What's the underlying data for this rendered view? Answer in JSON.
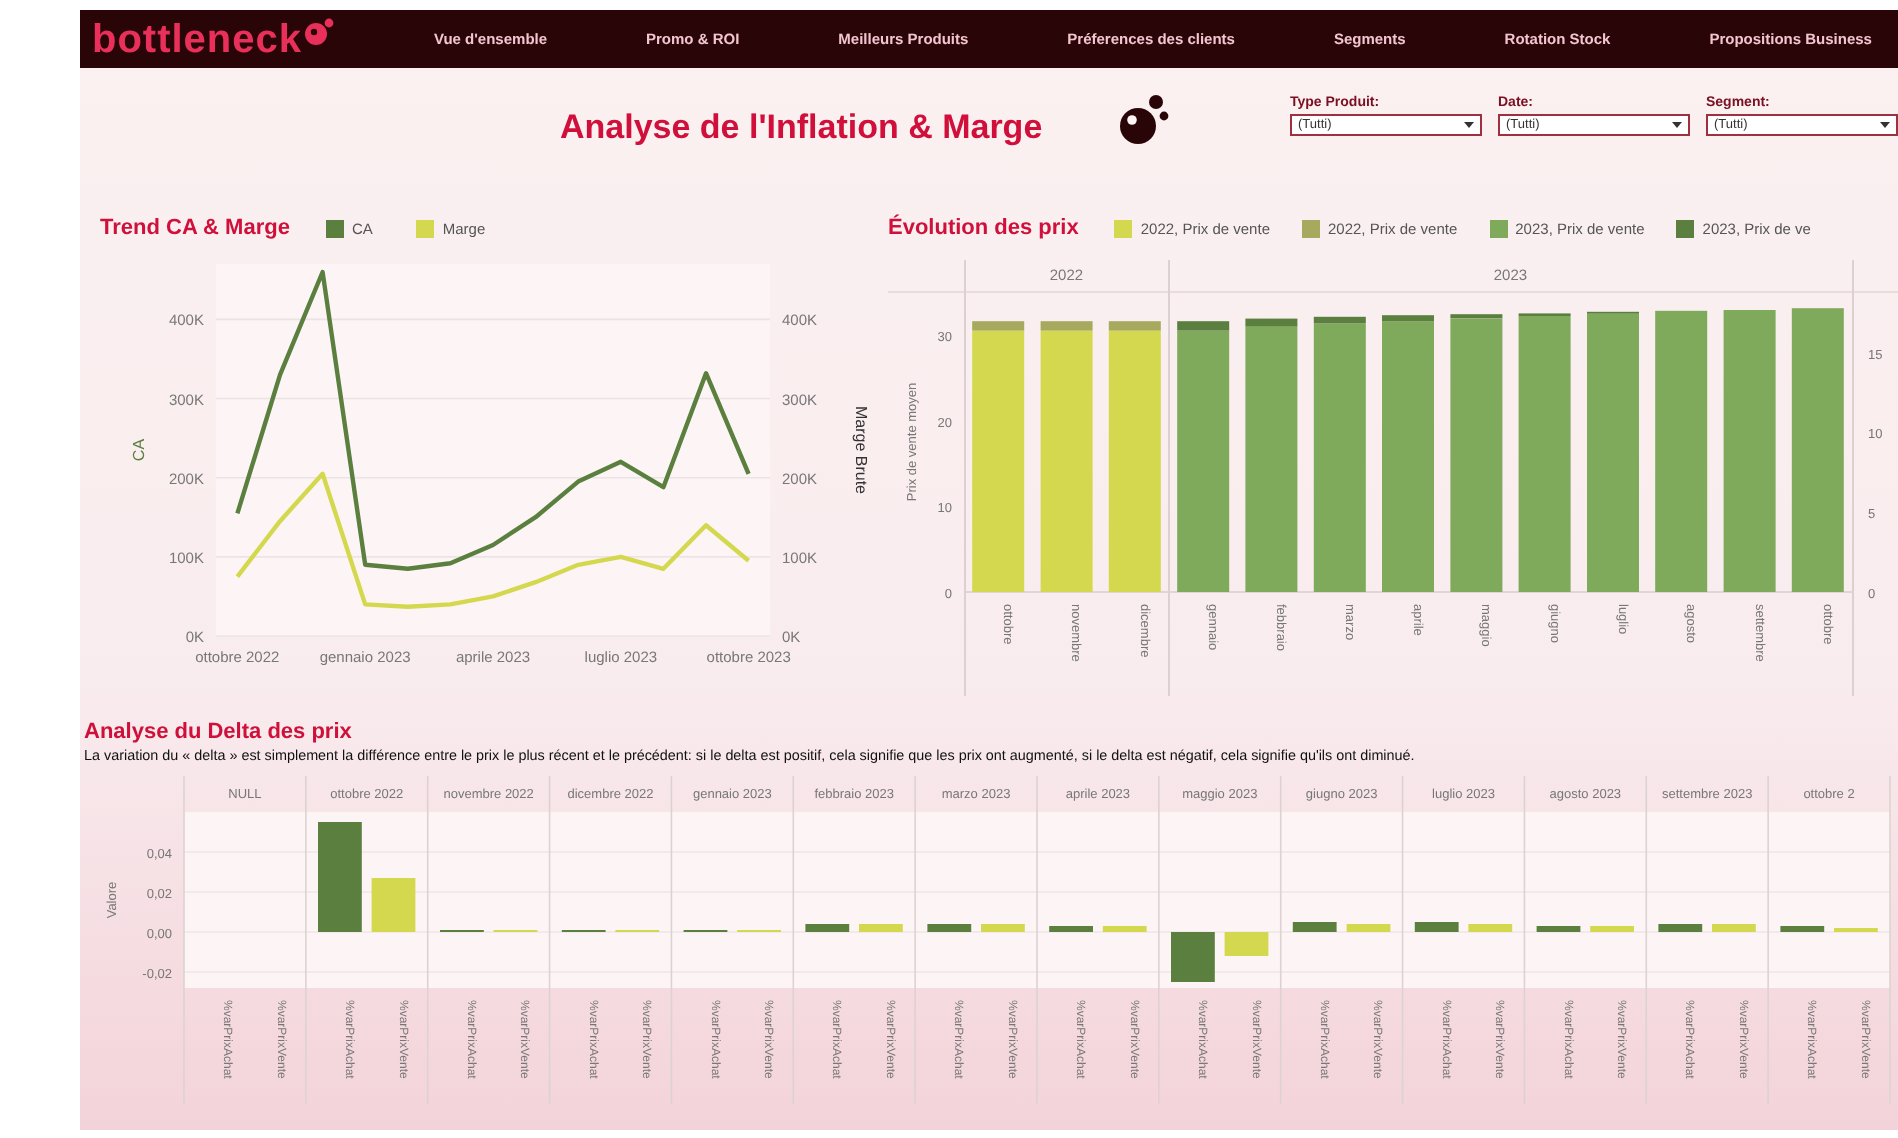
{
  "header": {
    "logo": "bottleneck",
    "nav": [
      {
        "label": "Vue d'ensemble",
        "selected": false
      },
      {
        "label": "Promo & ROI",
        "selected": false
      },
      {
        "label": "Meilleurs Produits",
        "selected": false
      },
      {
        "label": "Préferences des clients",
        "selected": false
      },
      {
        "label": "Segments",
        "selected": false
      },
      {
        "label": "Rotation Stock",
        "selected": false
      },
      {
        "label": "Propositions Business",
        "selected": false
      }
    ]
  },
  "title": "Analyse de l'Inflation & Marge",
  "filters": [
    {
      "label": "Type Produit:",
      "value": "(Tutti)"
    },
    {
      "label": "Date:",
      "value": "(Tutti)"
    },
    {
      "label": "Segment:",
      "value": "(Tutti)"
    }
  ],
  "trend": {
    "title": "Trend CA & Marge",
    "chart_data": {
      "type": "line",
      "ylabel": "CA",
      "y2label": "Marge Brute",
      "grid": true,
      "categories": [
        "ottobre 2022",
        null,
        null,
        "gennaio 2023",
        null,
        null,
        "aprile 2023",
        null,
        null,
        "luglio 2023",
        null,
        null,
        "ottobre 2023"
      ],
      "y2lim": [
        0,
        470000
      ],
      "series": [
        {
          "name": "CA",
          "color": "#5b7f3f",
          "values": [
            155000,
            330000,
            460000,
            90000,
            85000,
            92000,
            115000,
            150000,
            195000,
            220000,
            188000,
            332000,
            205000
          ]
        },
        {
          "name": "Marge",
          "color": "#d4d84f",
          "values": [
            75000,
            145000,
            205000,
            40000,
            37000,
            40000,
            50000,
            68000,
            90000,
            100000,
            85000,
            140000,
            95000
          ]
        }
      ],
      "ylim": [
        0,
        470000
      ],
      "yticks": [
        {
          "value": 0,
          "label": "0K"
        },
        {
          "value": 100000,
          "label": "100K"
        },
        {
          "value": 200000,
          "label": "200K"
        },
        {
          "value": 300000,
          "label": "300K"
        },
        {
          "value": 400000,
          "label": "400K"
        }
      ],
      "y2ticks": [
        {
          "value": 0,
          "label": "0K"
        },
        {
          "value": 100000,
          "label": "100K"
        },
        {
          "value": 200000,
          "label": "200K"
        },
        {
          "value": 300000,
          "label": "300K"
        },
        {
          "value": 400000,
          "label": "400K"
        }
      ]
    }
  },
  "prices": {
    "title": "Évolution des prix",
    "year_headers": [
      "2022",
      "2023"
    ],
    "chart_data": {
      "type": "bar",
      "stacked": true,
      "ylabel": "Prix de vente moyen",
      "categories": [
        "ottobre",
        "novembre",
        "dicembre",
        "gennaio",
        "febbraio",
        "marzo",
        "aprile",
        "maggio",
        "giugno",
        "luglio",
        "agosto",
        "settembre",
        "ottobre"
      ],
      "series": [
        {
          "name": "2022, Prix de vente",
          "color": "#d4d84f",
          "values": [
            30.5,
            30.5,
            30.5,
            null,
            null,
            null,
            null,
            null,
            null,
            null,
            null,
            null,
            null
          ]
        },
        {
          "name": "2022, Prix de vente",
          "color": "#a7a95f",
          "values": [
            1.1,
            1.1,
            1.1,
            null,
            null,
            null,
            null,
            null,
            null,
            null,
            null,
            null,
            null
          ]
        },
        {
          "name": "2023, Prix de vente",
          "color": "#7fa95b",
          "values": [
            null,
            null,
            null,
            30.5,
            31,
            31.3,
            31.6,
            31.9,
            32.2,
            32.5,
            32.8,
            32.9,
            33.1
          ]
        },
        {
          "name": "2023, Prix de ve",
          "color": "#5b7f3f",
          "values": [
            null,
            null,
            null,
            1.1,
            0.9,
            0.8,
            0.7,
            0.5,
            0.3,
            0.2,
            0,
            0,
            0
          ]
        }
      ],
      "ylim": [
        0,
        35
      ],
      "yticks": [
        0,
        10,
        20,
        30
      ],
      "y2lim": [
        0,
        18.8
      ],
      "y2ticks": [
        0,
        5,
        10,
        15
      ]
    }
  },
  "delta": {
    "title": "Analyse du Delta des prix",
    "description": "La variation du « delta » est simplement la différence entre le prix le plus récent et le précédent: si le delta est positif, cela signifie que les prix ont augmenté, si le delta est négatif, cela signifie qu'ils ont diminué.",
    "chart_data": {
      "type": "bar",
      "ylabel": "Valore",
      "grid": true,
      "categories": [
        "NULL",
        "ottobre 2022",
        "novembre 2022",
        "dicembre 2022",
        "gennaio 2023",
        "febbraio 2023",
        "marzo 2023",
        "aprile 2023",
        "maggio 2023",
        "giugno 2023",
        "luglio 2023",
        "agosto 2023",
        "settembre 2023",
        "ottobre 2"
      ],
      "series": [
        {
          "name": "%varPrixAchat",
          "color": "#5b7f3f",
          "values": [
            null,
            0.055,
            0.001,
            0.001,
            0.001,
            0.004,
            0.004,
            0.003,
            -0.025,
            0.005,
            0.005,
            0.003,
            0.004,
            0.003
          ]
        },
        {
          "name": "%varPrixVente",
          "color": "#d4d84f",
          "values": [
            null,
            0.027,
            0.001,
            0.001,
            0.001,
            0.004,
            0.004,
            0.003,
            -0.012,
            0.004,
            0.004,
            0.003,
            0.004,
            0.002
          ]
        }
      ],
      "ylim": [
        -0.028,
        0.06
      ],
      "yticks": [
        {
          "value": -0.02,
          "label": "-0,02"
        },
        {
          "value": 0,
          "label": "0,00"
        },
        {
          "value": 0.02,
          "label": "0,02"
        },
        {
          "value": 0.04,
          "label": "0,04"
        }
      ]
    }
  }
}
